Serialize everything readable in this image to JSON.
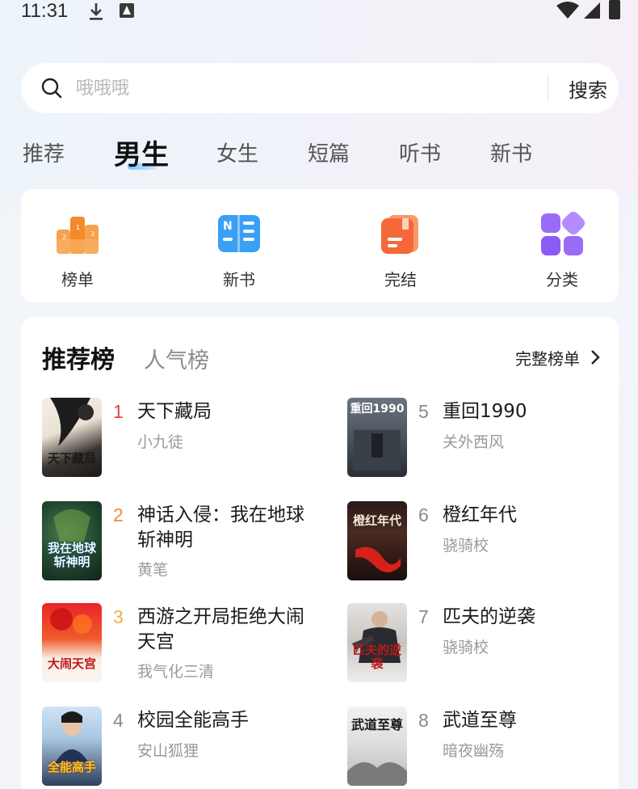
{
  "status_bar": {
    "time": "11:31",
    "icons": [
      "download-icon",
      "a-icon",
      "wifi-icon",
      "signal-icon",
      "battery-icon"
    ]
  },
  "search": {
    "placeholder": "哦哦哦",
    "button_label": "搜索"
  },
  "tabs": [
    {
      "label": "推荐",
      "active": false
    },
    {
      "label": "男生",
      "active": true
    },
    {
      "label": "女生",
      "active": false
    },
    {
      "label": "短篇",
      "active": false
    },
    {
      "label": "听书",
      "active": false
    },
    {
      "label": "新书",
      "active": false
    }
  ],
  "quick_entries": [
    {
      "label": "榜单",
      "icon": "podium-icon",
      "color": "#f59a3c"
    },
    {
      "label": "新书",
      "icon": "new-book-icon",
      "color": "#3aa0f5"
    },
    {
      "label": "完结",
      "icon": "finished-book-icon",
      "color": "#f5683a"
    },
    {
      "label": "分类",
      "icon": "category-grid-icon",
      "color": "#8a5cf5"
    }
  ],
  "ranking": {
    "tab_active": "推荐榜",
    "tab_other": "人气榜",
    "more_label": "完整榜单",
    "books": [
      {
        "rank": "1",
        "title": "天下藏局",
        "author": "小九徒",
        "rank_color": "#e84343",
        "cover_text": "天下藏局"
      },
      {
        "rank": "2",
        "title": "神话入侵：我在地球斩神明",
        "author": "黄笔",
        "rank_color": "#f08a3c",
        "cover_text": "我在地球斩神明"
      },
      {
        "rank": "3",
        "title": "西游之开局拒绝大闹天宫",
        "author": "我气化三清",
        "rank_color": "#f2b03c",
        "cover_text": "大闹天宫"
      },
      {
        "rank": "4",
        "title": "校园全能高手",
        "author": "安山狐狸",
        "rank_color": "#8a8a8a",
        "cover_text": "全能高手"
      },
      {
        "rank": "5",
        "title": "重回1990",
        "author": "关外西风",
        "rank_color": "#8a8a8a",
        "cover_text": "重回1990"
      },
      {
        "rank": "6",
        "title": "橙红年代",
        "author": "骁骑校",
        "rank_color": "#8a8a8a",
        "cover_text": "橙红年代"
      },
      {
        "rank": "7",
        "title": "匹夫的逆袭",
        "author": "骁骑校",
        "rank_color": "#8a8a8a",
        "cover_text": "匹夫的逆袭"
      },
      {
        "rank": "8",
        "title": "武道至尊",
        "author": "暗夜幽殇",
        "rank_color": "#8a8a8a",
        "cover_text": "武道至尊"
      }
    ]
  }
}
